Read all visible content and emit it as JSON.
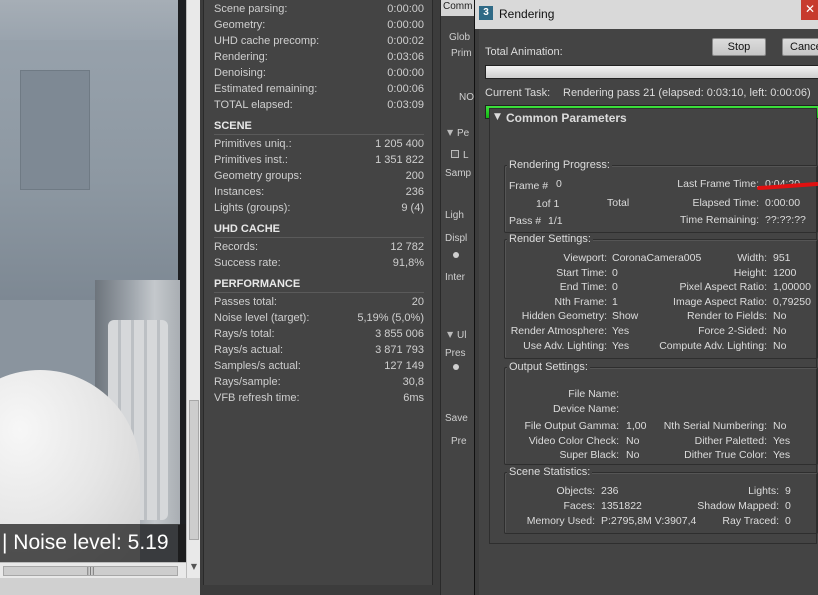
{
  "viewport": {
    "noise_text": "| Noise level: 5.19",
    "scroll_thumb_grip": "|||"
  },
  "stats": {
    "top_rows": [
      {
        "label": "Scene parsing:",
        "value": "0:00:00"
      },
      {
        "label": "Geometry:",
        "value": "0:00:00"
      },
      {
        "label": "UHD cache precomp:",
        "value": "0:00:02"
      },
      {
        "label": "Rendering:",
        "value": "0:03:06"
      },
      {
        "label": "Denoising:",
        "value": "0:00:00"
      },
      {
        "label": "Estimated remaining:",
        "value": "0:00:06"
      },
      {
        "label": "TOTAL elapsed:",
        "value": "0:03:09"
      }
    ],
    "scene_head": "SCENE",
    "scene_rows": [
      {
        "label": "Primitives uniq.:",
        "value": "1 205 400"
      },
      {
        "label": "Primitives inst.:",
        "value": "1 351 822"
      },
      {
        "label": "Geometry groups:",
        "value": "200"
      },
      {
        "label": "Instances:",
        "value": "236"
      },
      {
        "label": "Lights (groups):",
        "value": "9 (4)"
      }
    ],
    "uhd_head": "UHD CACHE",
    "uhd_rows": [
      {
        "label": "Records:",
        "value": "12 782"
      },
      {
        "label": "Success rate:",
        "value": "91,8%"
      }
    ],
    "perf_head": "PERFORMANCE",
    "perf_rows": [
      {
        "label": "Passes total:",
        "value": "20"
      },
      {
        "label": "Noise level (target):",
        "value": "5,19% (5,0%)"
      },
      {
        "label": "Rays/s total:",
        "value": "3 855 006"
      },
      {
        "label": "Rays/s actual:",
        "value": "3 871 793"
      },
      {
        "label": "Samples/s actual:",
        "value": "127 149"
      },
      {
        "label": "Rays/sample:",
        "value": "30,8"
      },
      {
        "label": "VFB refresh time:",
        "value": "6ms"
      }
    ]
  },
  "common_panel": {
    "title": "Comm",
    "items": [
      "Glob",
      "Prim",
      "NO",
      "Pe",
      "L",
      "Samp",
      "Ligh",
      "Displ",
      "Inter",
      "Ul",
      "Pres",
      "Save",
      "Pre"
    ]
  },
  "render_window": {
    "title": "Rendering",
    "app_icon": "3",
    "close_glyph": "✕",
    "total_animation_label": "Total Animation:",
    "stop_label": "Stop",
    "cancel_label": "Cancel",
    "current_task_label": "Current Task:",
    "current_task_value": "Rendering pass 21 (elapsed: 0:03:10, left: 0:00:06)",
    "total_progress": 0.0,
    "task_progress": 1.0,
    "rollout_title": "Common Parameters",
    "rollout_expander": "▼",
    "progress_group": {
      "title": "Rendering Progress:",
      "frame_label": "Frame #",
      "frame_value": "0",
      "of_text": "1of 1",
      "total_text": "Total",
      "pass_label": "Pass #",
      "pass_value": "1/1",
      "last_frame_time_label": "Last Frame Time:",
      "last_frame_time_value": "0:04:20",
      "elapsed_time_label": "Elapsed Time:",
      "elapsed_time_value": "0:00:00",
      "time_remaining_label": "Time Remaining:",
      "time_remaining_value": "??:??:??"
    },
    "render_settings": {
      "title": "Render Settings:",
      "left": [
        {
          "label": "Viewport:",
          "value": "CoronaCamera005"
        },
        {
          "label": "Start Time:",
          "value": "0"
        },
        {
          "label": "End Time:",
          "value": "0"
        },
        {
          "label": "Nth Frame:",
          "value": "1"
        },
        {
          "label": "Hidden Geometry:",
          "value": "Show"
        },
        {
          "label": "Render Atmosphere:",
          "value": "Yes"
        },
        {
          "label": "Use Adv. Lighting:",
          "value": "Yes"
        }
      ],
      "right": [
        {
          "label": "Width:",
          "value": "951"
        },
        {
          "label": "Height:",
          "value": "1200"
        },
        {
          "label": "Pixel Aspect Ratio:",
          "value": "1,00000"
        },
        {
          "label": "Image Aspect Ratio:",
          "value": "0,79250"
        },
        {
          "label": "Render to Fields:",
          "value": "No"
        },
        {
          "label": "Force 2-Sided:",
          "value": "No"
        },
        {
          "label": "Compute Adv. Lighting:",
          "value": "No"
        }
      ]
    },
    "output_settings": {
      "title": "Output Settings:",
      "file_name_label": "File Name:",
      "device_name_label": "Device Name:",
      "rows": [
        {
          "l_label": "File Output Gamma:",
          "l_value": "1,00",
          "r_label": "Nth Serial Numbering:",
          "r_value": "No"
        },
        {
          "l_label": "Video Color Check:",
          "l_value": "No",
          "r_label": "Dither Paletted:",
          "r_value": "Yes"
        },
        {
          "l_label": "Super Black:",
          "l_value": "No",
          "r_label": "Dither True Color:",
          "r_value": "Yes"
        }
      ]
    },
    "scene_statistics": {
      "title": "Scene Statistics:",
      "rows": [
        {
          "l_label": "Objects:",
          "l_value": "236",
          "r_label": "Lights:",
          "r_value": "9"
        },
        {
          "l_label": "Faces:",
          "l_value": "1351822",
          "r_label": "Shadow Mapped:",
          "r_value": "0"
        },
        {
          "l_label": "Memory Used:",
          "l_value": "P:2795,8M V:3907,4",
          "r_label": "Ray Traced:",
          "r_value": "0"
        }
      ]
    },
    "colors": {
      "task_bar": "#18c818",
      "close_button": "#c73b2e",
      "annotation_mark": "#e01010"
    }
  }
}
